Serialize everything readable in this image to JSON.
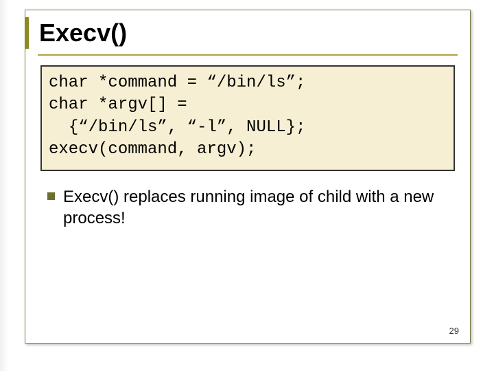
{
  "slide": {
    "title": "Execv()",
    "code_lines": [
      "char *command = “/bin/ls”;",
      "char *argv[] =",
      "  {“/bin/ls”, “-l”, NULL};",
      "execv(command, argv);"
    ],
    "bullet": "Execv() replaces running image of child with a new process!",
    "page_number": "29"
  }
}
